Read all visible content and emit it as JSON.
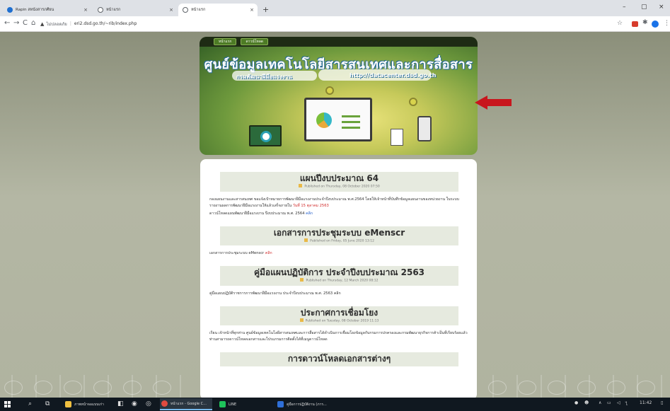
{
  "browser": {
    "tabs": [
      {
        "title": "Rapin สหนังสารภศียน",
        "active": false
      },
      {
        "title": "หน้าแรก",
        "active": false
      },
      {
        "title": "หน้าแรก",
        "active": true
      }
    ],
    "new_tab": "+",
    "window_controls": {
      "minimize": "–",
      "maximize": "▢",
      "close": "×"
    },
    "nav": {
      "back": "←",
      "forward": "→",
      "reload": "C",
      "home": "⌂"
    },
    "address": {
      "warning": "▲",
      "security_label": "ไม่ปลอดภัย",
      "url": "eri2.dsd.go.th/~rib/index.php"
    },
    "toolbar_icons": {
      "star": "☆",
      "extensions": "✱",
      "menu": "⋮"
    }
  },
  "banner": {
    "nav": [
      "หน้าแรก",
      "ดาวน์โหลด"
    ],
    "title": "ศูนย์ข้อมูลเทคโนโลยีสารสนเทศและการสื่อสาร",
    "subtitle": "กรมพัฒนาฝีมือแรงงาน",
    "url": "http://datacenter.dsd.go.th"
  },
  "articles": [
    {
      "title": "แผนปีงบประมาณ 64",
      "published": "Published on Thursday, 08 October 2020 07:50",
      "body": "กองแผนงานและสารสนเทศ ขอแจ้งเป้าหมายการพัฒนาฝีมือแรงงานประจำปีงบประมาณ พ.ศ.2564 โดยให้เจ้าหน้าที่บันทึกข้อมูลแผนงานของหน่วยงาน ในระบบรายงานผลการพัฒนาฝีมือแรงงานให้แล้วเสร็จภายใน",
      "deadline": "วันที่ 15 ตุลาคม 2563",
      "download_text": "ดาวน์โหลดแผนพัฒนาฝีมือแรงงาน ปีงบประมาณ พ.ศ. 2564",
      "download_link": "คลิก"
    },
    {
      "title": "เอกสารการประชุมระบบ eMenscr",
      "published": "Published on Friday, 05 June 2020 13:12",
      "body": "เอกสารการประชุมระบบ eMenscr",
      "link": "คลิก"
    },
    {
      "title": "คู่มือแผนปฏิบัติการ ประจำปีงบประมาณ 2563",
      "published": "Published on Thursday, 12 March 2020 08:12",
      "body": "คู่มือแผนปฏิบัติราชการการพัฒนาฝีมือแรงงาน ประจำปีงบประมาณ พ.ศ. 2563",
      "link": "คลิก"
    },
    {
      "title": "ประกาศการเชื่อมโยง",
      "published": "Published on Tuesday, 08 October 2019 11:13",
      "body": "เรียน เจ้าหน้าที่ทุกท่าน ศูนย์ข้อมูลเทคโนโลยีสารสนเทศและการสื่อสารได้ดำเนินการเชื่อมโยงข้อมูลกับกรมการปกครองและกรมพัฒนาธุรกิจการค้าเป็นที่เรียบร้อยแล้ว ท่านสามารถดาวน์โหลดเอกสารและโปรแกรมการติดตั้งได้ที่เมนูดาวน์โหลด"
    },
    {
      "title": "การดาวน์โหลดเอกสารต่างๆ"
    }
  ],
  "taskbar": {
    "items": [
      {
        "label": "ภาพหน้าจอแบบเก่า",
        "color": "#f0c040",
        "active": false
      },
      {
        "label": "หน้าแรก - Google C...",
        "color": "#e04a3f",
        "active": true
      },
      {
        "label": "LINE",
        "color": "#1ec25a",
        "active": false
      },
      {
        "label": "คู่มือการปฏิบัติงาน (ภาร...",
        "color": "#2f6fd8",
        "active": false
      }
    ],
    "clock": "11:42"
  },
  "colors": {
    "accent_red": "#c8161d",
    "banner_green": "#4d7b25",
    "link": "#1c59c9"
  }
}
